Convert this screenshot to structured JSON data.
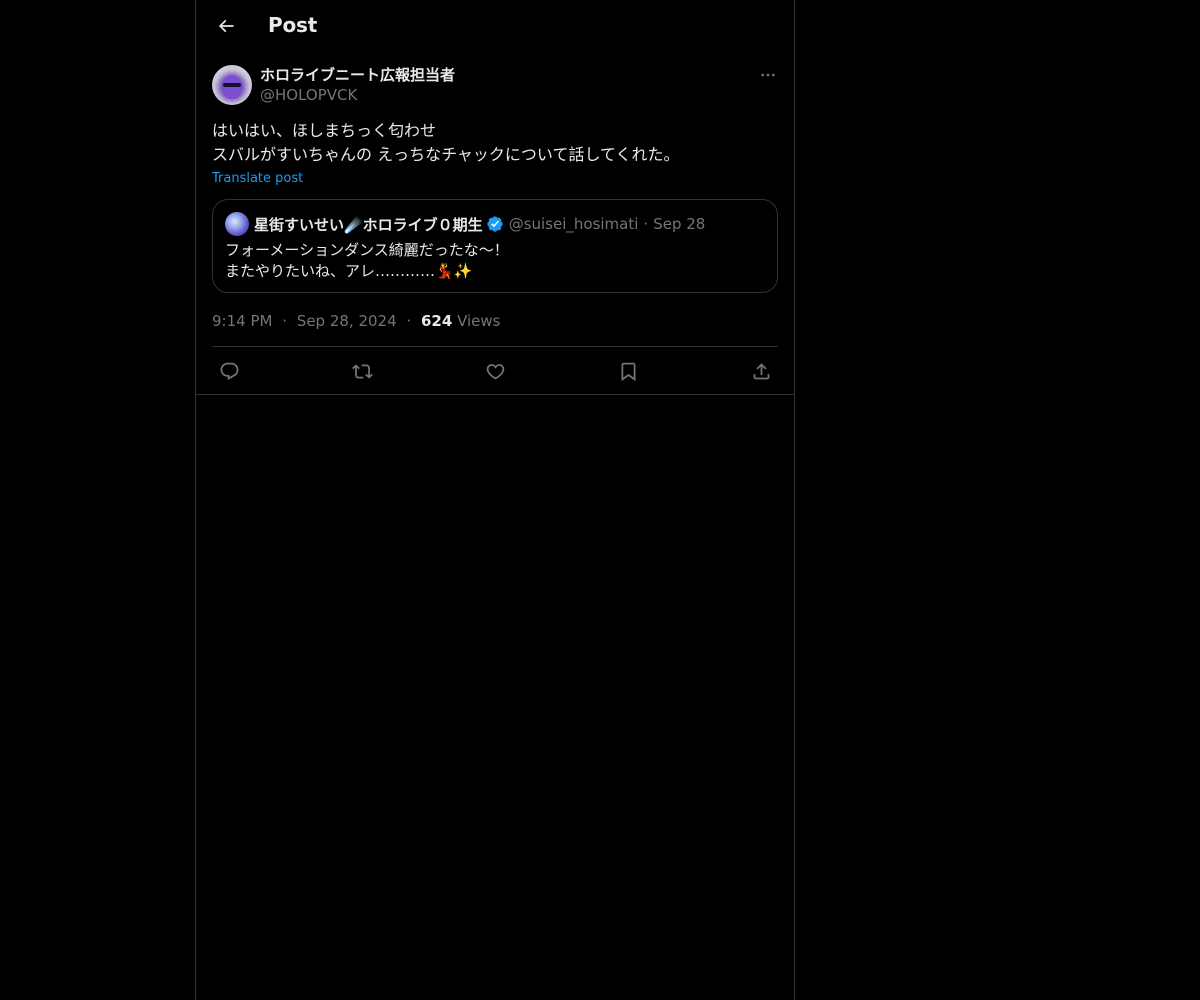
{
  "header": {
    "title": "Post",
    "back_icon": "arrow-left-icon"
  },
  "post": {
    "author": {
      "display_name": "ホロライブニート広報担当者",
      "handle": "@HOLOPVCK"
    },
    "text_lines": [
      "はいはい、ほしまちっく匂わせ",
      "スバルがすいちゃんの えっちなチャックについて話してくれた。"
    ],
    "translate_label": "Translate post",
    "quote": {
      "display_name": "星街すいせい☄️ホロライブ０期生",
      "handle": "@suisei_hosimati",
      "separator": "·",
      "date": "Sep 28",
      "verified": true,
      "text_lines": [
        "フォーメーションダンス綺麗だったな〜！",
        "またやりたいね、アレ…………💃✨"
      ]
    },
    "meta": {
      "time": "9:14 PM",
      "separator": "·",
      "date": "Sep 28, 2024",
      "views_count": "624",
      "views_label": "Views"
    }
  },
  "actions": [
    {
      "name": "reply",
      "icon": "reply-icon"
    },
    {
      "name": "repost",
      "icon": "repost-icon"
    },
    {
      "name": "like",
      "icon": "heart-icon"
    },
    {
      "name": "bookmark",
      "icon": "bookmark-icon"
    },
    {
      "name": "share",
      "icon": "share-icon"
    }
  ],
  "colors": {
    "background": "#000000",
    "text_primary": "#e7e9ea",
    "text_secondary": "#71767b",
    "accent": "#1d9bf0",
    "border": "#2f3336"
  }
}
